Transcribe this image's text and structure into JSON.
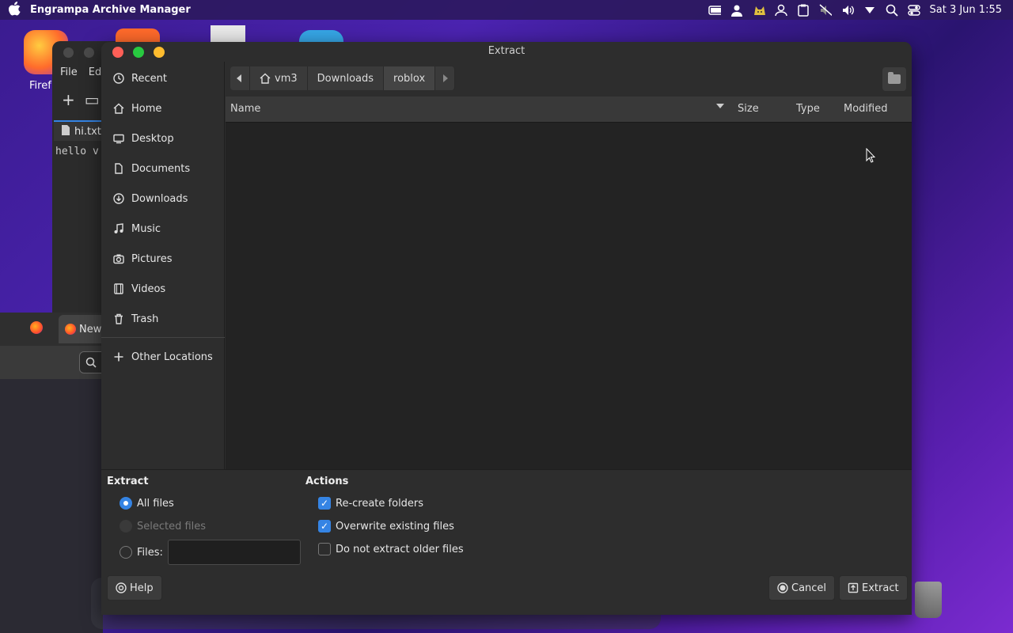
{
  "menubar": {
    "app_title": "Engrampa Archive Manager",
    "clock": "Sat 3 Jun  1:55",
    "tray_icons": [
      "battery-icon",
      "user-icon",
      "cat-icon",
      "accounts-icon",
      "clipboard-icon",
      "mute-icon",
      "volume-icon",
      "chevron-down-icon",
      "search-icon",
      "toggle-icon"
    ]
  },
  "desktop": {
    "firefox_label": "Firef"
  },
  "background_window": {
    "menu": [
      "File",
      "Ed"
    ],
    "tab_label": "hi.txt",
    "text_content": "hello v"
  },
  "browser": {
    "tab_label": "New"
  },
  "dialog": {
    "title": "Extract",
    "sidebar": {
      "items": [
        {
          "label": "Recent",
          "icon": "clock-icon"
        },
        {
          "label": "Home",
          "icon": "home-icon"
        },
        {
          "label": "Desktop",
          "icon": "desktop-icon"
        },
        {
          "label": "Documents",
          "icon": "documents-icon"
        },
        {
          "label": "Downloads",
          "icon": "downloads-icon"
        },
        {
          "label": "Music",
          "icon": "music-icon"
        },
        {
          "label": "Pictures",
          "icon": "camera-icon"
        },
        {
          "label": "Videos",
          "icon": "film-icon"
        },
        {
          "label": "Trash",
          "icon": "trash-icon"
        }
      ],
      "other_locations": "Other Locations"
    },
    "path": [
      "vm3",
      "Downloads",
      "roblox"
    ],
    "columns": {
      "name": "Name",
      "size": "Size",
      "type": "Type",
      "modified": "Modified"
    },
    "extract_section": {
      "title": "Extract",
      "all_files": "All files",
      "selected_files": "Selected files",
      "files_label": "Files:",
      "files_value": ""
    },
    "actions_section": {
      "title": "Actions",
      "recreate_folders": "Re-create folders",
      "overwrite_existing": "Overwrite existing files",
      "do_not_extract_older": "Do not extract older files"
    },
    "buttons": {
      "help": "Help",
      "cancel": "Cancel",
      "extract": "Extract"
    }
  }
}
